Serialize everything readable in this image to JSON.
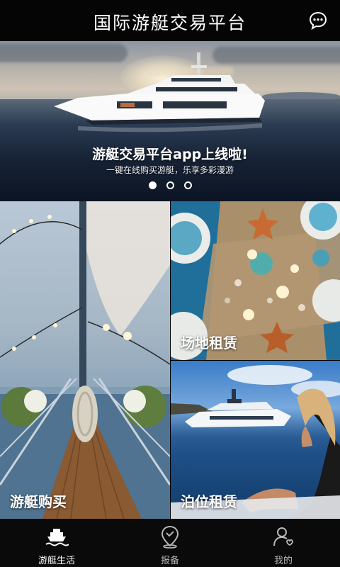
{
  "header": {
    "title": "国际游艇交易平台",
    "chat_icon": "chat-bubble-icon"
  },
  "banner": {
    "title": "游艇交易平台app上线啦!",
    "subtitle": "一键在线购买游艇，乐享多彩漫游",
    "slide_count": 3,
    "active_slide": 1
  },
  "tiles": [
    {
      "id": "buy",
      "label": "游艇购买"
    },
    {
      "id": "venue",
      "label": "场地租赁"
    },
    {
      "id": "berth",
      "label": "泊位租赁"
    }
  ],
  "nav": {
    "items": [
      {
        "label": "游艇生活",
        "icon": "yacht-icon",
        "active": true
      },
      {
        "label": "报备",
        "icon": "location-pin-icon",
        "active": false
      },
      {
        "label": "我的",
        "icon": "profile-icon",
        "active": false
      }
    ]
  },
  "colors": {
    "header_bg": "#050505",
    "nav_bg": "#0a0a0a",
    "nav_active": "#ffffff",
    "nav_inactive": "#b8b8b8"
  }
}
